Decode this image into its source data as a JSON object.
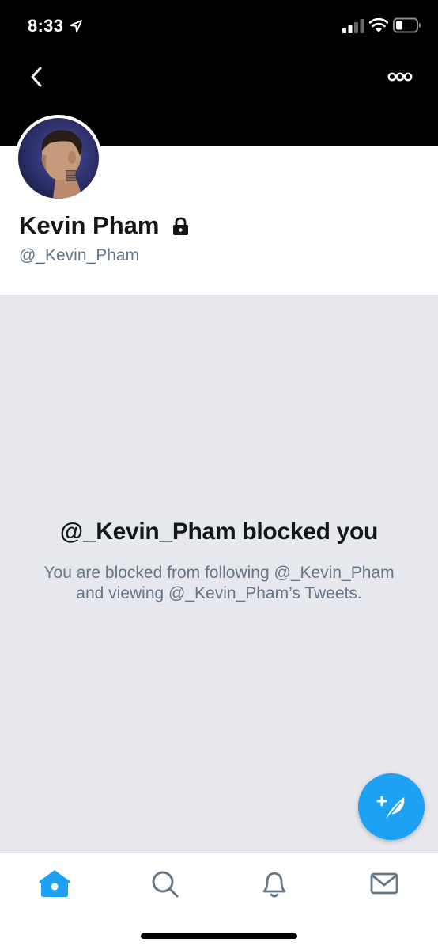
{
  "status_bar": {
    "time": "8:33"
  },
  "profile": {
    "name": "Kevin Pham",
    "handle": "@_Kevin_Pham",
    "protected": true
  },
  "blocked": {
    "title": "@_Kevin_Pham blocked you",
    "message": "You are blocked from following @_Kevin_Pham and viewing @_Kevin_Pham’s Tweets."
  },
  "tabs": [
    {
      "icon": "home-icon",
      "active": true
    },
    {
      "icon": "search-icon",
      "active": false
    },
    {
      "icon": "notifications-bell-icon",
      "active": false
    },
    {
      "icon": "messages-envelope-icon",
      "active": false
    }
  ],
  "colors": {
    "accent": "#1da1f2",
    "header_background": "#000000",
    "blocked_background": "#e6e8ed",
    "secondary_text": "#657786",
    "primary_text": "#14171a"
  }
}
